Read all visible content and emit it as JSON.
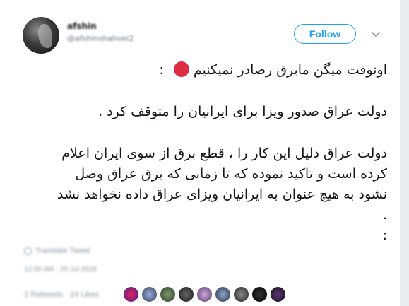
{
  "tweet": {
    "author_name": "afshin",
    "author_handle": "@afshinshahvei2",
    "follow_label": "Follow",
    "line1": "اونوقت میگن مابرق رصادر نمیکنیم",
    "line1_colon": ":",
    "line2": "دولت عراق صدور ویزا برای ایرانیان را متوقف کرد .",
    "para_lines": [
      "دولت عراق دلیل این کار را ، قطع برق از سوی ایران اعلام",
      "کرده است و تاکید نموده که تا زمانی که برق عراق وصل",
      "نشود به هیچ عنوان به ایرانیان ویزای عراق داده نخواهد نشد",
      ".",
      ":"
    ],
    "translate_label": "Translate Tweet",
    "timestamp": "12:00 AM - 20 Jul 2018",
    "retweets": "2 Retweets",
    "likes": "24 Likes"
  },
  "colors": {
    "accent": "#1da1f2",
    "red_circle": "#dd2e44"
  },
  "icons": [
    "chevron-down-icon",
    "red-circle-emoji",
    "globe-icon"
  ]
}
